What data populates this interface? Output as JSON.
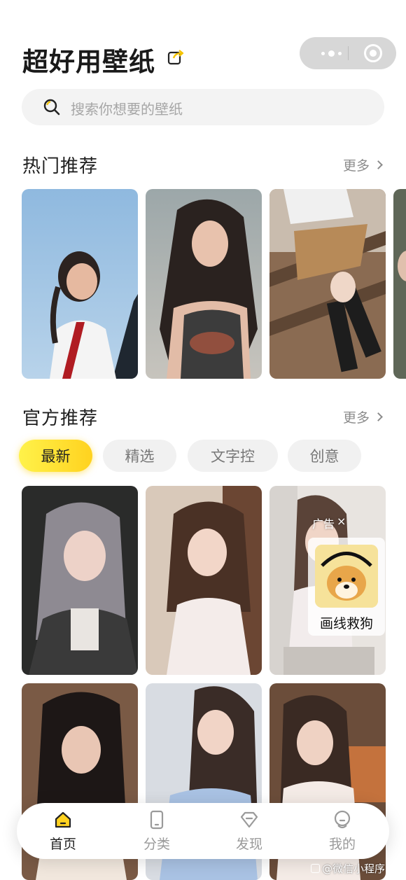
{
  "header": {
    "title": "超好用壁纸",
    "share_icon": "share-icon",
    "capsule_icons": [
      "more-icon",
      "close-icon"
    ]
  },
  "search": {
    "placeholder": "搜索你想要的壁纸",
    "icon": "search-icon"
  },
  "hot_section": {
    "title": "热门推荐",
    "more_label": "更多",
    "images": [
      "wallpaper",
      "wallpaper",
      "wallpaper",
      "wallpaper"
    ]
  },
  "official_section": {
    "title": "官方推荐",
    "more_label": "更多",
    "tabs": [
      {
        "label": "最新",
        "active": true
      },
      {
        "label": "精选",
        "active": false
      },
      {
        "label": "文字控",
        "active": false
      },
      {
        "label": "创意",
        "active": false
      }
    ]
  },
  "ad": {
    "label": "广告",
    "close": "×",
    "name": "画线救狗"
  },
  "tabbar": {
    "items": [
      {
        "label": "首页",
        "icon": "home-icon",
        "active": true
      },
      {
        "label": "分类",
        "icon": "phone-icon",
        "active": false
      },
      {
        "label": "发现",
        "icon": "diamond-icon",
        "active": false
      },
      {
        "label": "我的",
        "icon": "profile-icon",
        "active": false
      }
    ]
  },
  "watermark": "@微信小程序",
  "colors": {
    "accent": "#ffd21f",
    "active_tab_start": "#fff24a",
    "text": "#1f1f1f",
    "muted": "#8c8c8c"
  }
}
